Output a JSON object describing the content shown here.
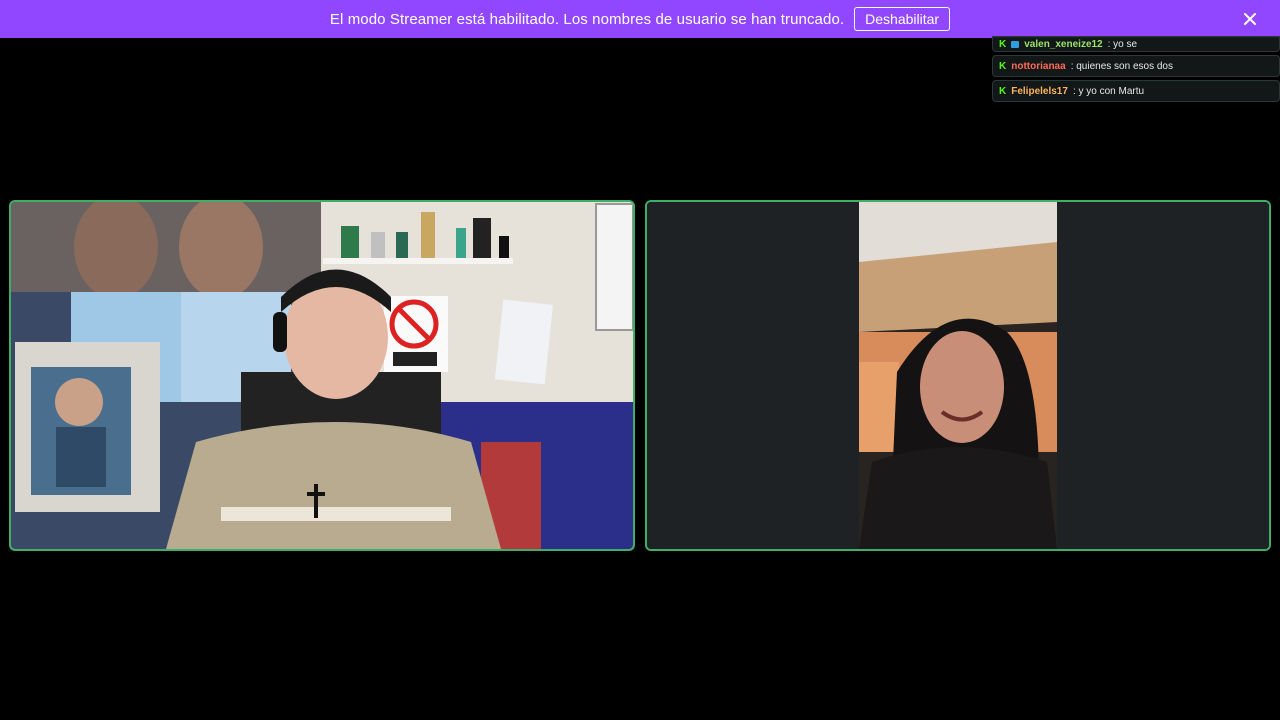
{
  "banner": {
    "message": "El modo Streamer está habilitado. Los nombres de usuario se han truncado.",
    "button_label": "Deshabilitar",
    "close_icon": "close-icon",
    "bg_color": "#9147ff"
  },
  "chat": {
    "messages": [
      {
        "user": "valen_xeneize12",
        "text": ": yo se",
        "user_color": "#9be36a",
        "badges": [
          "kick-icon",
          "subscriber-badge-icon"
        ]
      },
      {
        "user": "nottorianaa",
        "text": ": quienes son esos dos",
        "user_color": "#ff6b5a",
        "badges": [
          "kick-icon"
        ]
      },
      {
        "user": "Felipelels17",
        "text": ": y yo con Martu",
        "user_color": "#ffb35c",
        "badges": [
          "kick-icon"
        ]
      }
    ]
  },
  "videos": {
    "border_color": "#3fae66",
    "left_tile": "webcam-video",
    "right_tile": "guest-video"
  }
}
